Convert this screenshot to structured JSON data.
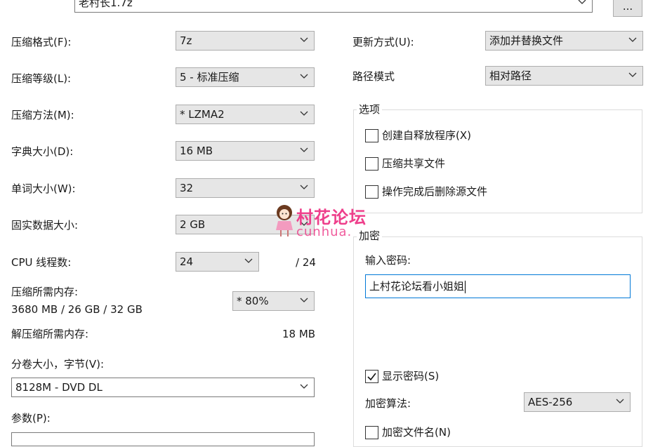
{
  "archive": {
    "filename": "老村长1.7z",
    "browse_label": "..."
  },
  "left": {
    "format": {
      "label": "压缩格式(F):",
      "value": "7z"
    },
    "level": {
      "label": "压缩等级(L):",
      "value": "5 - 标准压缩"
    },
    "method": {
      "label": "压缩方法(M):",
      "value": "*  LZMA2"
    },
    "dictionary": {
      "label": "字典大小(D):",
      "value": "16 MB"
    },
    "word": {
      "label": "单词大小(W):",
      "value": "32"
    },
    "solid": {
      "label": "固实数据大小:",
      "value": "2 GB"
    },
    "threads": {
      "label": "CPU 线程数:",
      "value": "24",
      "max": "/ 24"
    },
    "memory": {
      "label": "压缩所需内存:",
      "value": "3680 MB / 26 GB / 32 GB",
      "percent": "*  80%"
    },
    "decompress_memory": {
      "label": "解压缩所需内存:",
      "value": "18 MB"
    },
    "volume": {
      "label": "分卷大小，字节(V):",
      "value": "8128M - DVD DL"
    },
    "params": {
      "label": "参数(P):",
      "value": ""
    }
  },
  "right": {
    "update_mode": {
      "label": "更新方式(U):",
      "value": "添加并替换文件"
    },
    "path_mode": {
      "label": "路径模式",
      "value": "相对路径"
    },
    "options": {
      "title": "选项",
      "sfx": {
        "label": "创建自释放程序(X)",
        "checked": false
      },
      "shared": {
        "label": "压缩共享文件",
        "checked": false
      },
      "delete": {
        "label": "操作完成后删除源文件",
        "checked": false
      }
    },
    "encryption": {
      "title": "加密",
      "password_label": "输入密码:",
      "password_value": "上村花论坛看小姐姐",
      "show_password": {
        "label": "显示密码(S)",
        "checked": true
      },
      "method_label": "加密算法:",
      "method_value": "AES-256",
      "encrypt_names": {
        "label": "加密文件名(N)",
        "checked": false
      }
    }
  },
  "watermark": {
    "main": "村花论坛",
    "sub": "cunhua."
  }
}
